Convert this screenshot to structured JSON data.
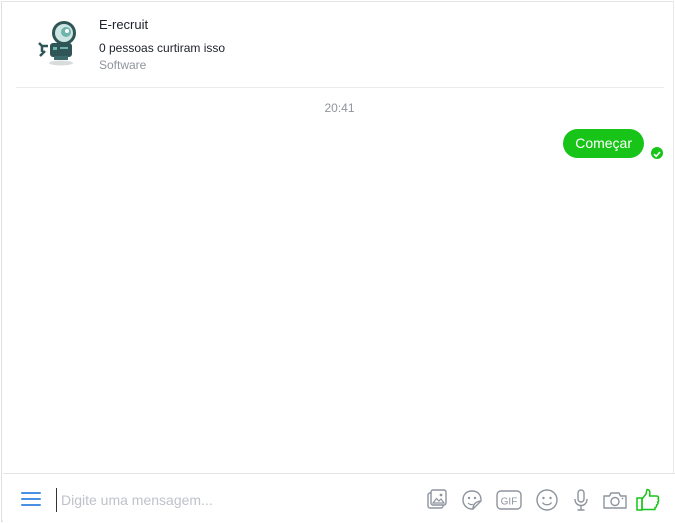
{
  "page": {
    "name": "E-recruit",
    "likes": "0 pessoas curtiram isso",
    "category": "Software"
  },
  "conversation": {
    "timestamp": "20:41",
    "messages": [
      {
        "from": "me",
        "text": "Começar",
        "status": "seen"
      }
    ]
  },
  "composer": {
    "placeholder": "Digite uma mensagem...",
    "tools": [
      "menu-icon",
      "photo-icon",
      "sticker-icon",
      "gif-icon",
      "emoji-icon",
      "microphone-icon",
      "camera-icon",
      "thumbs-up-icon"
    ],
    "gif_label": "GIF"
  },
  "colors": {
    "accent": "#19c419",
    "menu": "#4a90e2",
    "icon_gray": "#8d949e"
  }
}
